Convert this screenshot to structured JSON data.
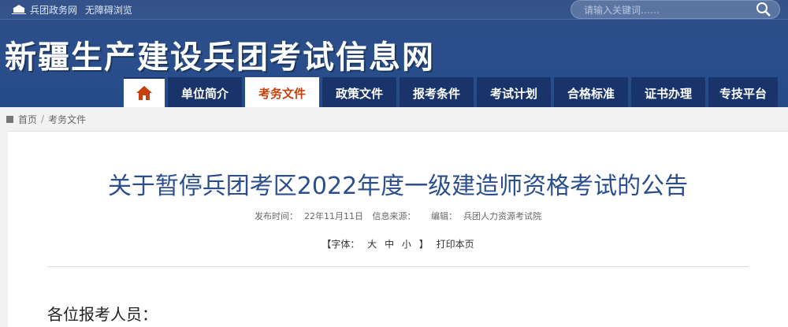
{
  "topbar": {
    "gov_link": "兵团政务网",
    "accessibility_link": "无障碍浏览"
  },
  "search": {
    "placeholder": "请输入关键词……",
    "icon": "search-icon"
  },
  "site": {
    "title": "新疆生产建设兵团考试信息网"
  },
  "nav": {
    "home_icon": "home-icon",
    "items": [
      {
        "label": "单位简介"
      },
      {
        "label": "考务文件"
      },
      {
        "label": "政策文件"
      },
      {
        "label": "报考条件"
      },
      {
        "label": "考试计划"
      },
      {
        "label": "合格标准"
      },
      {
        "label": "证书办理"
      },
      {
        "label": "专技平台"
      }
    ],
    "active_index": 1
  },
  "breadcrumb": {
    "home": "首页",
    "separator": "/",
    "current": "考务文件"
  },
  "article": {
    "title": "关于暂停兵团考区2022年度一级建造师资格考试的公告",
    "publish_label": "发布时间：",
    "publish_date": "22年11月11日",
    "source_label": "信息来源：",
    "source_value": "",
    "editor_label": "编辑：",
    "editor_value": "兵团人力资源考试院",
    "font_label_open": "【字体：",
    "font_large": "大",
    "font_medium": "中",
    "font_small": "小",
    "font_label_close": "】",
    "print_label": "打印本页",
    "greeting": "各位报考人员："
  },
  "colors": {
    "header_bg": "#2a4f8c",
    "nav_bg": "#18346a",
    "active_nav_text": "#c4410f",
    "title_color": "#2b4e8c"
  }
}
